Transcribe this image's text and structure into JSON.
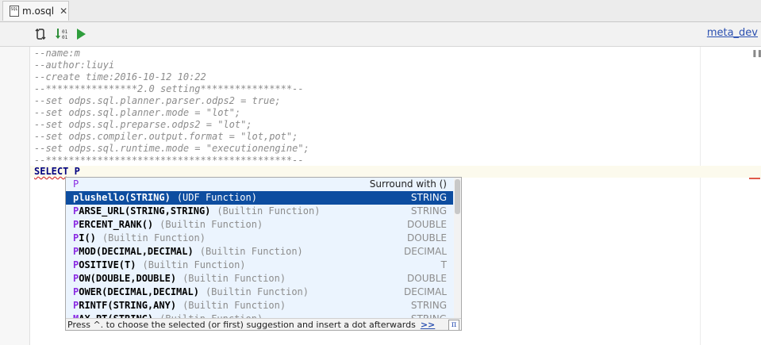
{
  "tab": {
    "title": "m.osql",
    "file_icon_text": "SQL"
  },
  "toolbar": {
    "connection": "meta_dev"
  },
  "code_lines": [
    "--name:m",
    "--author:liuyi",
    "--create time:2016-10-12 10:22",
    "--****************2.0 setting****************--",
    "--set odps.sql.planner.parser.odps2 = true;",
    "--set odps.sql.planner.mode = \"lot\";",
    "--set odps.sql.preparse.odps2 = \"lot\";",
    "--set odps.compiler.output.format = \"lot,pot\";",
    "--set odps.sql.runtime.mode = \"executionengine\";",
    "--*******************************************--"
  ],
  "current_line": {
    "keyword": "SELECT",
    "typed": "P"
  },
  "completion": {
    "header": {
      "prefix": "P",
      "action": "Surround with ()"
    },
    "items": [
      {
        "first": "p",
        "rest": "lushello(STRING)",
        "kind": "(UDF Function)",
        "type": "STRING"
      },
      {
        "first": "P",
        "rest": "ARSE_URL(STRING,STRING)",
        "kind": "(Builtin Function)",
        "type": "STRING"
      },
      {
        "first": "P",
        "rest": "ERCENT_RANK()",
        "kind": "(Builtin Function)",
        "type": "DOUBLE"
      },
      {
        "first": "P",
        "rest": "I()",
        "kind": "(Builtin Function)",
        "type": "DOUBLE"
      },
      {
        "first": "P",
        "rest": "MOD(DECIMAL,DECIMAL)",
        "kind": "(Builtin Function)",
        "type": "DECIMAL"
      },
      {
        "first": "P",
        "rest": "OSITIVE(T)",
        "kind": "(Builtin Function)",
        "type": "T"
      },
      {
        "first": "P",
        "rest": "OW(DOUBLE,DOUBLE)",
        "kind": "(Builtin Function)",
        "type": "DOUBLE"
      },
      {
        "first": "P",
        "rest": "OWER(DECIMAL,DECIMAL)",
        "kind": "(Builtin Function)",
        "type": "DECIMAL"
      },
      {
        "first": "P",
        "rest": "RINTF(STRING,ANY)",
        "kind": "(Builtin Function)",
        "type": "STRING"
      },
      {
        "first": "M",
        "rest": "AX_PT(STRING)",
        "kind": "(Builtin Function)",
        "type": "STRING"
      }
    ],
    "selected_index": 0,
    "footer": "Press ^. to choose the selected (or first) suggestion and insert a dot afterwards",
    "footer_link": ">>",
    "pin": "π"
  },
  "colors": {
    "selection": "#0d4da0",
    "popup_bg": "#ebf4fe",
    "prefix_highlight": "#8a2be2",
    "link": "#2a4fb0"
  }
}
